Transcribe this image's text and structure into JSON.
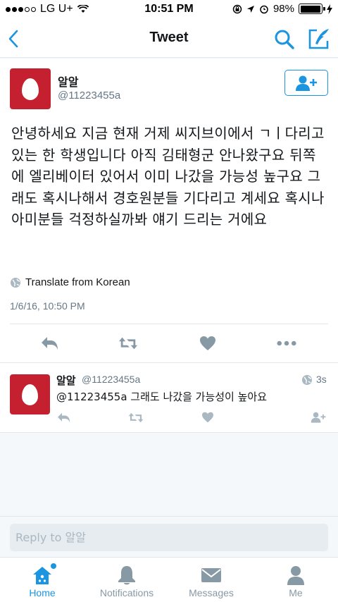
{
  "status_bar": {
    "carrier": "LG U+",
    "time": "10:51 PM",
    "battery": "98%",
    "battery_level": 0.98
  },
  "nav": {
    "title": "Tweet",
    "back_icon": "chevron-left-icon",
    "search_icon": "search-icon",
    "compose_icon": "compose-icon"
  },
  "main_tweet": {
    "name": "알알",
    "handle": "@11223455a",
    "text": "안녕하세요 지금 현재 거제 씨지브이에서 ㄱㅣ다리고 있는 한 학생입니다 아직 김태형군 안나왔구요 뒤쪽에 엘리베이터 있어서 이미 나갔을 가능성 높구요 그래도 혹시나해서 경호원분들 기다리고 계세요 혹시나 아미분들 걱정하실까봐 얘기 드리는 거에요",
    "translate_label": "Translate from Korean",
    "timestamp": "1/6/16, 10:50 PM"
  },
  "reply_tweet": {
    "name": "알알",
    "handle": "@11223455a",
    "age": "3s",
    "text": "@11223455a 그래도 나갔을 가능성이 높아요"
  },
  "composer": {
    "placeholder": "Reply to 알알"
  },
  "tabs": [
    {
      "label": "Home",
      "icon": "home-icon",
      "active": true
    },
    {
      "label": "Notifications",
      "icon": "bell-icon",
      "active": false
    },
    {
      "label": "Messages",
      "icon": "envelope-icon",
      "active": false
    },
    {
      "label": "Me",
      "icon": "person-icon",
      "active": false
    }
  ],
  "colors": {
    "accent": "#1b95e0",
    "avatar_bg": "#c4202f",
    "muted": "#657786",
    "icon_gray": "#8899a6",
    "background": "#f5f8fa"
  }
}
